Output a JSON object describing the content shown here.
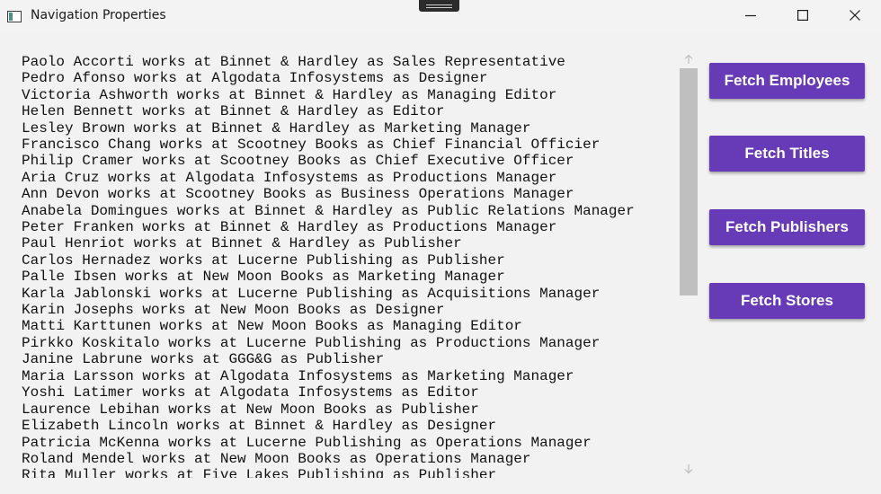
{
  "window": {
    "title": "Navigation Properties"
  },
  "employees_list": [
    "Paolo Accorti works at Binnet & Hardley as Sales Representative",
    "Pedro Afonso works at Algodata Infosystems as Designer",
    "Victoria Ashworth works at Binnet & Hardley as Managing Editor",
    "Helen Bennett works at Binnet & Hardley as Editor",
    "Lesley Brown works at Binnet & Hardley as Marketing Manager",
    "Francisco Chang works at Scootney Books as Chief Financial Officier",
    "Philip Cramer works at Scootney Books as Chief Executive Officer",
    "Aria Cruz works at Algodata Infosystems as Productions Manager",
    "Ann Devon works at Scootney Books as Business Operations Manager",
    "Anabela Domingues works at Binnet & Hardley as Public Relations Manager",
    "Peter Franken works at Binnet & Hardley as Productions Manager",
    "Paul Henriot works at Binnet & Hardley as Publisher",
    "Carlos Hernadez works at Lucerne Publishing as Publisher",
    "Palle Ibsen works at New Moon Books as Marketing Manager",
    "Karla Jablonski works at Lucerne Publishing as Acquisitions Manager",
    "Karin Josephs works at New Moon Books as Designer",
    "Matti Karttunen works at New Moon Books as Managing Editor",
    "Pirkko Koskitalo works at Lucerne Publishing as Productions Manager",
    "Janine Labrune works at GGG&G as Publisher",
    "Maria Larsson works at Algodata Infosystems as Marketing Manager",
    "Yoshi Latimer works at Algodata Infosystems as Editor",
    "Laurence Lebihan works at New Moon Books as Publisher",
    "Elizabeth Lincoln works at Binnet & Hardley as Designer",
    "Patricia McKenna works at Lucerne Publishing as Operations Manager",
    "Roland Mendel works at New Moon Books as Operations Manager",
    "Rita Muller works at Five Lakes Publishing as Publisher"
  ],
  "buttons": {
    "fetch_employees": "Fetch Employees",
    "fetch_titles": "Fetch Titles",
    "fetch_publishers": "Fetch Publishers",
    "fetch_stores": "Fetch Stores"
  },
  "colors": {
    "accent": "#673ab7",
    "background": "#f2f2f2",
    "text": "#111111"
  },
  "icons": {
    "app": "window-icon",
    "minimize": "minimize-icon",
    "maximize": "maximize-icon",
    "close": "close-icon",
    "scroll_up": "arrow-up-icon",
    "scroll_down": "arrow-down-icon"
  }
}
